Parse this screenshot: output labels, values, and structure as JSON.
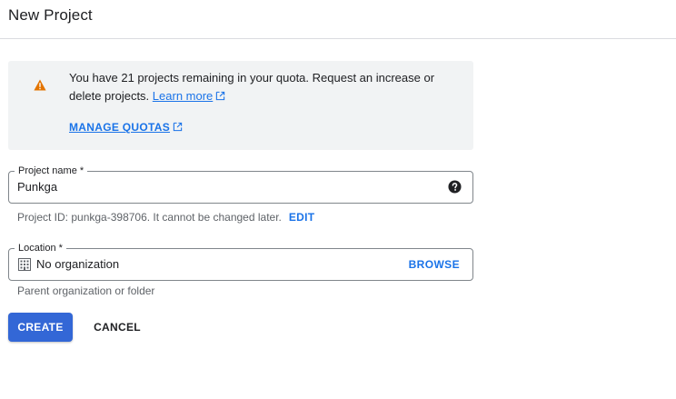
{
  "header": {
    "title": "New Project"
  },
  "quota_notice": {
    "icon": "warning-icon",
    "icon_color": "#e37400",
    "message_line1": "You have 21 projects remaining in your quota. Request an increase or",
    "message_line2": "delete projects.",
    "learn_more": "Learn more",
    "manage_quotas": "MANAGE QUOTAS"
  },
  "project_name": {
    "label": "Project name *",
    "value": "Punkga",
    "help_icon": "help-icon",
    "hint_prefix": "Project ID: punkga-398706. It cannot be changed later.",
    "edit": "EDIT"
  },
  "location": {
    "label": "Location *",
    "icon": "organization-icon",
    "value": "No organization",
    "browse": "BROWSE",
    "hint": "Parent organization or folder"
  },
  "actions": {
    "create": "CREATE",
    "cancel": "CANCEL"
  },
  "colors": {
    "accent": "#1a73e8",
    "primary_button": "#3367d6",
    "notice_bg": "#f1f3f4"
  }
}
